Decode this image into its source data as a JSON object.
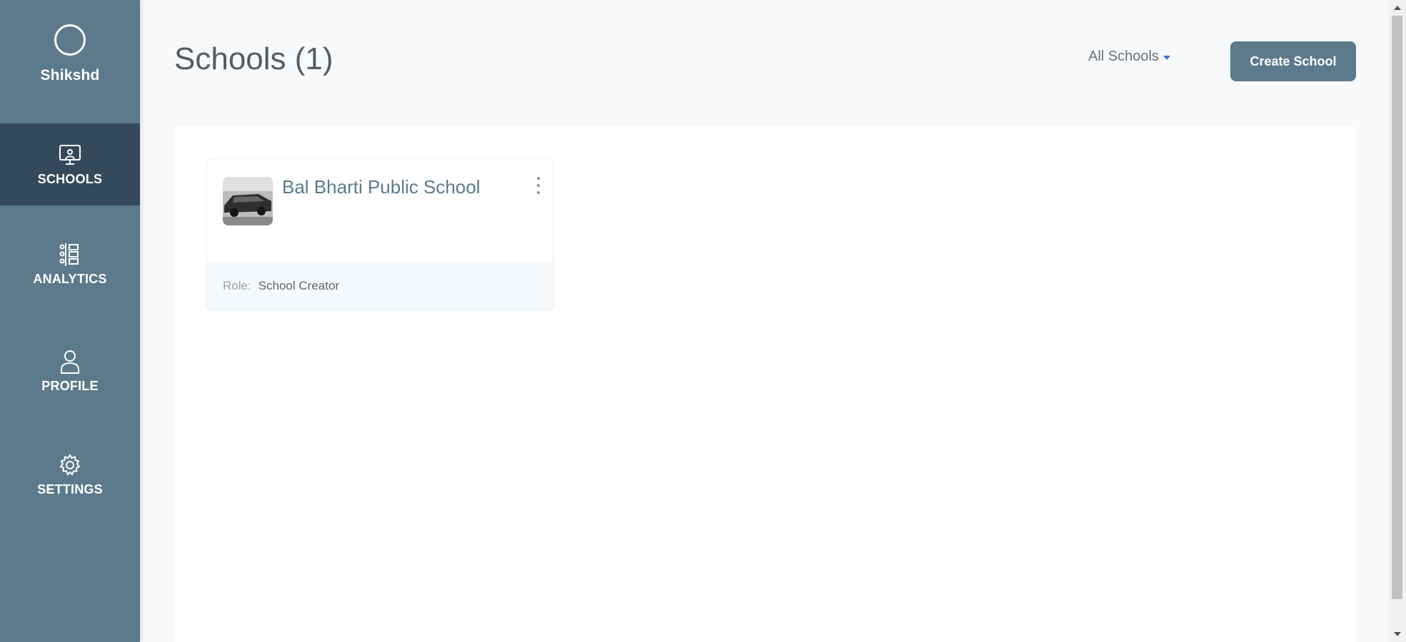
{
  "sidebar": {
    "brand": "Shikshd",
    "items": [
      {
        "label": "SCHOOLS",
        "icon": "presentation-board-icon",
        "active": true
      },
      {
        "label": "ANALYTICS",
        "icon": "analytics-icon",
        "active": false
      },
      {
        "label": "PROFILE",
        "icon": "user-icon",
        "active": false
      },
      {
        "label": "SETTINGS",
        "icon": "gear-icon",
        "active": false
      }
    ]
  },
  "header": {
    "title": "Schools (1)",
    "filter_label": "All Schools",
    "create_label": "Create School"
  },
  "schools": [
    {
      "name": "Bal Bharti Public School",
      "role_label": "Role:",
      "role": "School Creator"
    }
  ],
  "colors": {
    "sidebar": "#5c7a8b",
    "sidebar_active": "#34495a",
    "accent": "#5c7a8b",
    "caret": "#4b6bd6"
  }
}
